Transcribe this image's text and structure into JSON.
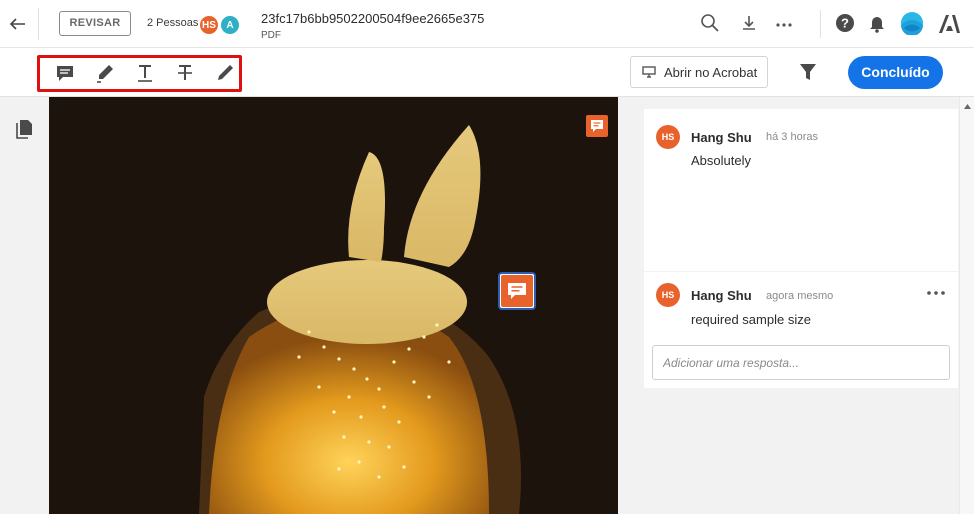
{
  "header": {
    "review_label": "REVISAR",
    "people_label": "2 Pessoas",
    "avatars": [
      {
        "initials": "HS",
        "color": "#e8632b"
      },
      {
        "initials": "A",
        "color": "#2fb0c6"
      }
    ],
    "doc_title": "23fc17b6bb9502200504f9ee2665e375",
    "doc_type": "PDF"
  },
  "toolbar": {
    "tools": [
      "comment-icon",
      "highlight-icon",
      "underline-icon",
      "strikethrough-icon",
      "draw-icon"
    ],
    "open_acrobat_label": "Abrir no Acrobat",
    "done_label": "Concluído"
  },
  "comments": [
    {
      "initials": "HS",
      "author": "Hang Shu",
      "time": "há 3 horas",
      "text": "Absolutely"
    },
    {
      "initials": "HS",
      "author": "Hang Shu",
      "time": "agora mesmo",
      "text": "required sample size"
    }
  ],
  "reply": {
    "placeholder": "Adicionar uma resposta..."
  },
  "colors": {
    "accent": "#1473e6",
    "pin": "#e8632b",
    "highlight_box": "#e01010"
  }
}
